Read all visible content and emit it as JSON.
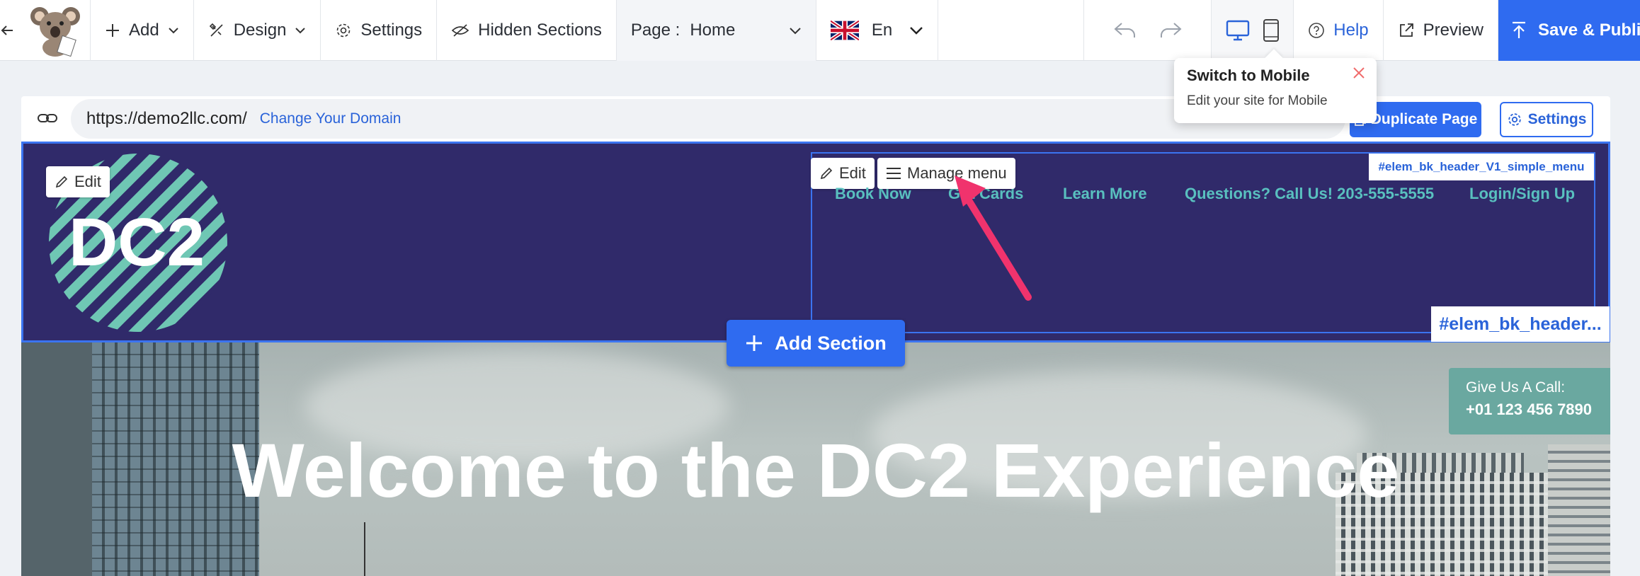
{
  "toolbar": {
    "add_label": "Add",
    "design_label": "Design",
    "settings_label": "Settings",
    "hidden_sections_label": "Hidden Sections",
    "page_prefix": "Page :",
    "page_value": "Home",
    "language": "En",
    "help_label": "Help",
    "preview_label": "Preview",
    "save_label": "Save & Publish"
  },
  "tooltip": {
    "title": "Switch to Mobile",
    "body": "Edit your site for Mobile"
  },
  "urlbar": {
    "url": "https://demo2llc.com/",
    "change_domain": "Change Your Domain",
    "duplicate_label": "Duplicate Page",
    "settings_label": "Settings"
  },
  "header": {
    "logo_text": "DC2",
    "edit_label": "Edit",
    "menu_edit_label": "Edit",
    "manage_menu_label": "Manage menu",
    "nav": [
      "Book Now",
      "Gift Cards",
      "Learn More",
      "Questions? Call Us! 203-555-5555",
      "Login/Sign Up"
    ],
    "element_tag_small": "#elem_bk_header_V1_simple_menu",
    "element_tag_large": "#elem_bk_header..."
  },
  "add_section_label": "Add Section",
  "hero": {
    "title": "Welcome to the DC2 Experience",
    "call_label": "Give Us A Call:",
    "call_number": "+01 123 456 7890"
  },
  "colors": {
    "accent": "#2f6bf0",
    "header_bg": "#302a6a",
    "nav_link": "#59c0bf",
    "annotation_arrow": "#f0336d"
  }
}
